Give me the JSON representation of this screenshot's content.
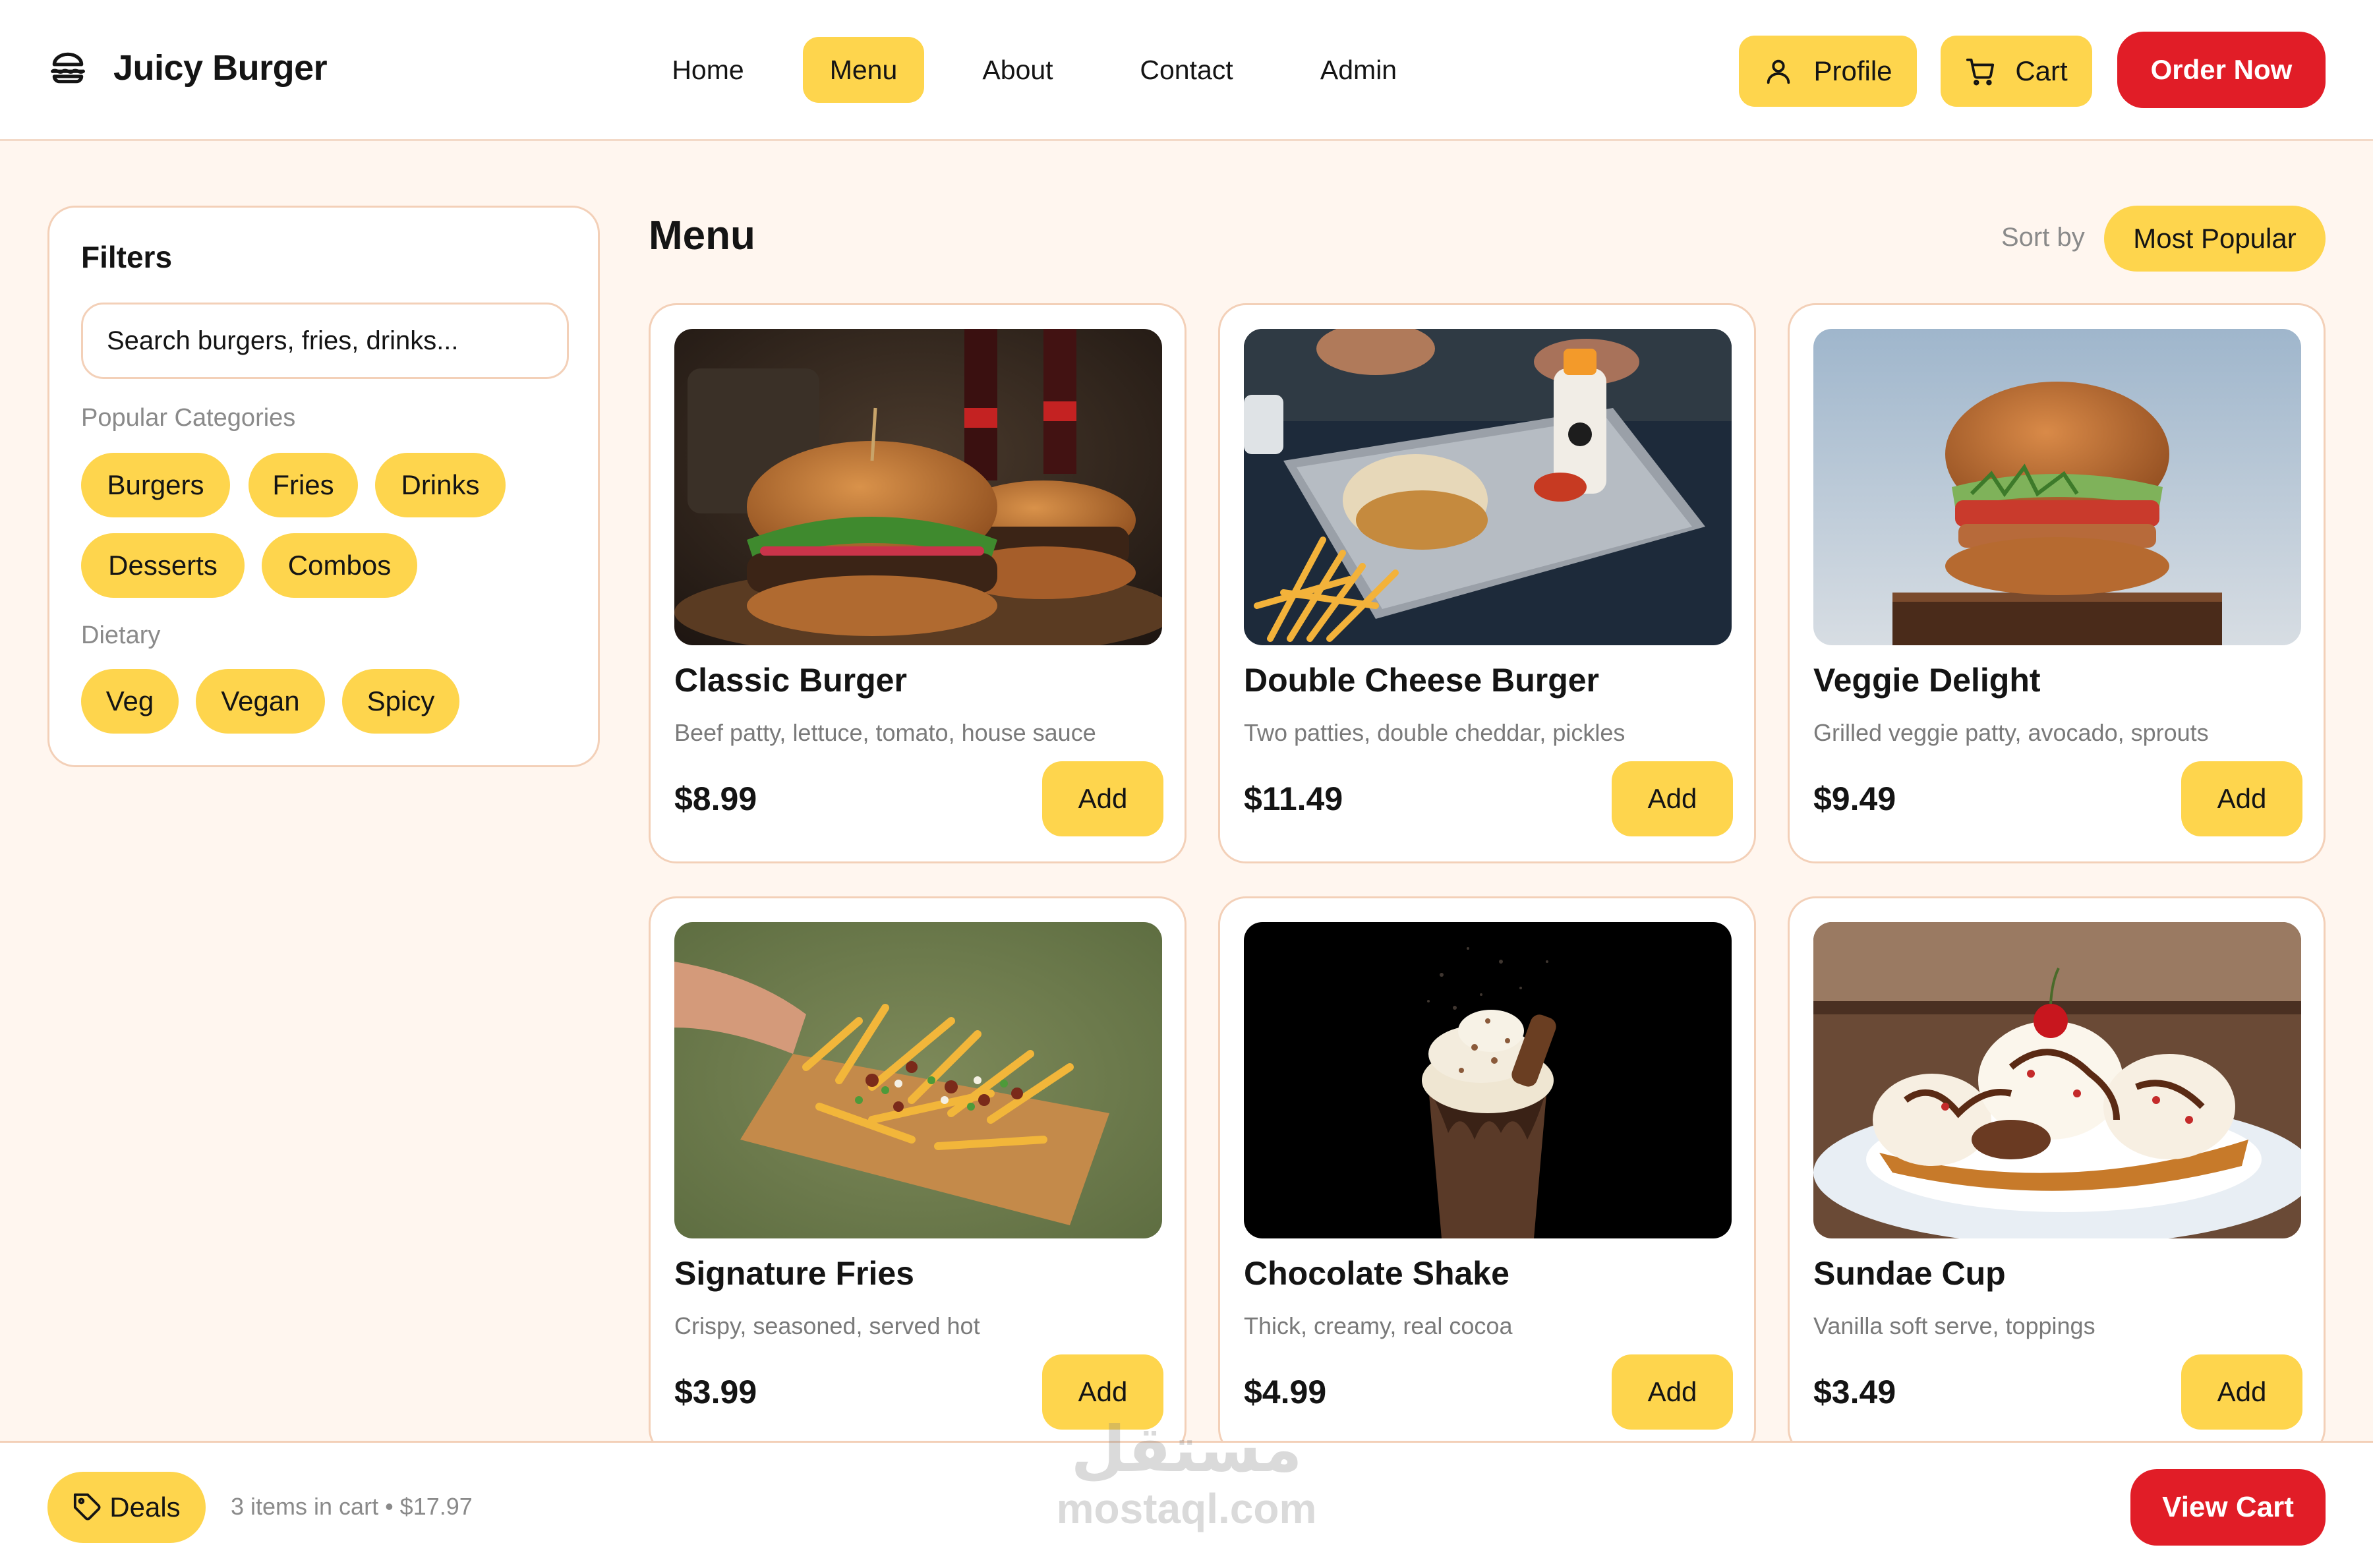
{
  "brand": {
    "name": "Juicy Burger",
    "icon": "burger-icon"
  },
  "nav": {
    "items": [
      {
        "label": "Home",
        "active": false
      },
      {
        "label": "Menu",
        "active": true
      },
      {
        "label": "About",
        "active": false
      },
      {
        "label": "Contact",
        "active": false
      },
      {
        "label": "Admin",
        "active": false
      }
    ]
  },
  "header_actions": {
    "profile_label": "Profile",
    "profile_icon": "user-icon",
    "cart_label": "Cart",
    "cart_icon": "cart-icon",
    "order_label": "Order Now"
  },
  "filters": {
    "title": "Filters",
    "search_placeholder": "Search burgers, fries, drinks...",
    "popular_label": "Popular Categories",
    "categories": [
      "Burgers",
      "Fries",
      "Drinks",
      "Desserts",
      "Combos"
    ],
    "dietary_label": "Dietary",
    "dietary": [
      "Veg",
      "Vegan",
      "Spicy"
    ]
  },
  "main": {
    "title": "Menu",
    "sort_label": "Sort by",
    "sort_value": "Most Popular"
  },
  "products": [
    {
      "name": "Classic Burger",
      "desc": "Beef patty, lettuce, tomato, house sauce",
      "price": "$8.99",
      "add_label": "Add",
      "image": "classic-burger-photo"
    },
    {
      "name": "Double Cheese Burger",
      "desc": "Two patties, double cheddar, pickles",
      "price": "$11.49",
      "add_label": "Add",
      "image": "double-cheese-burger-photo"
    },
    {
      "name": "Veggie Delight",
      "desc": "Grilled veggie patty, avocado, sprouts",
      "price": "$9.49",
      "add_label": "Add",
      "image": "veggie-burger-photo"
    },
    {
      "name": "Signature Fries",
      "desc": "Crispy, seasoned, served hot",
      "price": "$3.99",
      "add_label": "Add",
      "image": "loaded-fries-photo"
    },
    {
      "name": "Chocolate Shake",
      "desc": "Thick, creamy, real cocoa",
      "price": "$4.99",
      "add_label": "Add",
      "image": "chocolate-shake-photo"
    },
    {
      "name": "Sundae Cup",
      "desc": "Vanilla soft serve, toppings",
      "price": "$3.49",
      "add_label": "Add",
      "image": "sundae-photo"
    }
  ],
  "footer": {
    "deals_label": "Deals",
    "deals_icon": "tag-icon",
    "cart_summary": "3 items in cart • $17.97",
    "view_cart_label": "View Cart"
  },
  "watermark": {
    "mark": "مستقل",
    "text": "mostaql.com"
  },
  "colors": {
    "accent": "#fed54d",
    "primary_red": "#e11d27",
    "background": "#fff6ef",
    "border": "#f3d0b8"
  }
}
